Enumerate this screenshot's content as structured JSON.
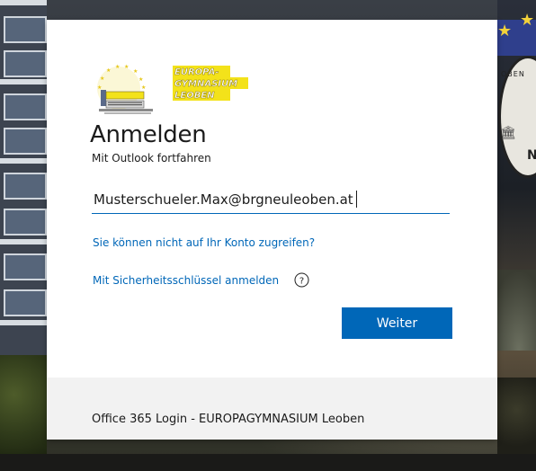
{
  "signin": {
    "logo": {
      "icon": "europa-gymnasium-logo",
      "text_line1": "EUROPA-",
      "text_line2": "GYMNASIUM",
      "text_line3": "LEOBEN"
    },
    "title": "Anmelden",
    "subtitle": "Mit Outlook fortfahren",
    "email_value": "Musterschueler.Max@brgneuleoben.at",
    "no_access_link": "Sie können nicht auf Ihr Konto zugreifen?",
    "security_key_link": "Mit Sicherheitsschlüssel anmelden",
    "help_icon": "question-circle-icon",
    "next_button": "Weiter",
    "footer": "Office 365 Login - EUROPAGYMNASIUM Leoben"
  },
  "colors": {
    "accent": "#0067b8",
    "footer_bg": "#f2f2f2",
    "logo_yellow": "#f3e21a"
  }
}
